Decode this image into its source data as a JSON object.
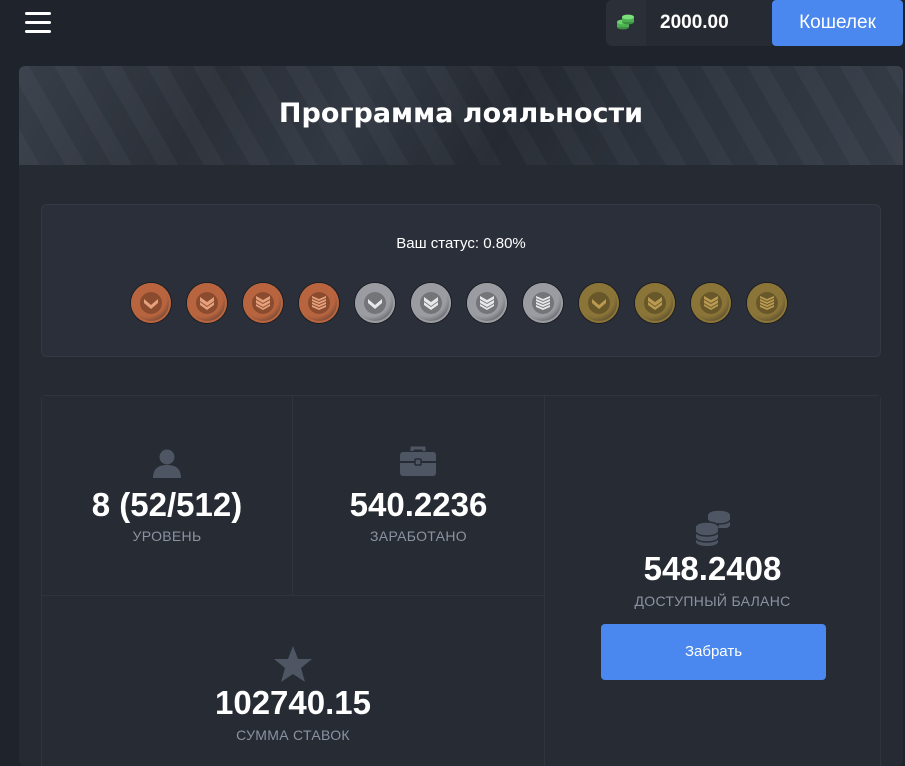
{
  "header": {
    "balance": "2000.00",
    "wallet_button": "Кошелек",
    "icons": {
      "menu": "hamburger-icon",
      "money": "money-stack-icon"
    },
    "money_icon_color": "#4caf50"
  },
  "page": {
    "title": "Программа лояльности",
    "status_text": "Ваш статус: 0.80%",
    "medals": [
      {
        "tier": "bronze",
        "level": 1,
        "color": "#b8653f"
      },
      {
        "tier": "bronze",
        "level": 2,
        "color": "#b8653f"
      },
      {
        "tier": "bronze",
        "level": 3,
        "color": "#b8653f"
      },
      {
        "tier": "bronze",
        "level": 4,
        "color": "#b8653f"
      },
      {
        "tier": "silver",
        "level": 1,
        "color": "#9a9ca1"
      },
      {
        "tier": "silver",
        "level": 2,
        "color": "#9a9ca1"
      },
      {
        "tier": "silver",
        "level": 3,
        "color": "#9a9ca1"
      },
      {
        "tier": "silver",
        "level": 4,
        "color": "#9a9ca1"
      },
      {
        "tier": "gold",
        "level": 1,
        "color": "#8a7437"
      },
      {
        "tier": "gold",
        "level": 2,
        "color": "#8a7437"
      },
      {
        "tier": "gold",
        "level": 3,
        "color": "#8a7437"
      },
      {
        "tier": "gold",
        "level": 4,
        "color": "#8a7437"
      }
    ]
  },
  "stats": {
    "level": {
      "value": "8 (52/512)",
      "label": "УРОВЕНЬ",
      "icon": "user-icon"
    },
    "earned": {
      "value": "540.2236",
      "label": "ЗАРАБОТАНО",
      "icon": "briefcase-icon"
    },
    "bets_sum": {
      "value": "102740.15",
      "label": "СУММА СТАВОК",
      "icon": "star-icon"
    },
    "available_balance": {
      "value": "548.2408",
      "label": "ДОСТУПНЫЙ БАЛАНС",
      "icon": "coins-icon"
    },
    "claim_button": "Забрать"
  },
  "colors": {
    "accent": "#4a88f0",
    "background": "#1f232b",
    "panel": "#252a33",
    "muted_text": "#8b93a1",
    "icon_gray": "#4e5664"
  }
}
